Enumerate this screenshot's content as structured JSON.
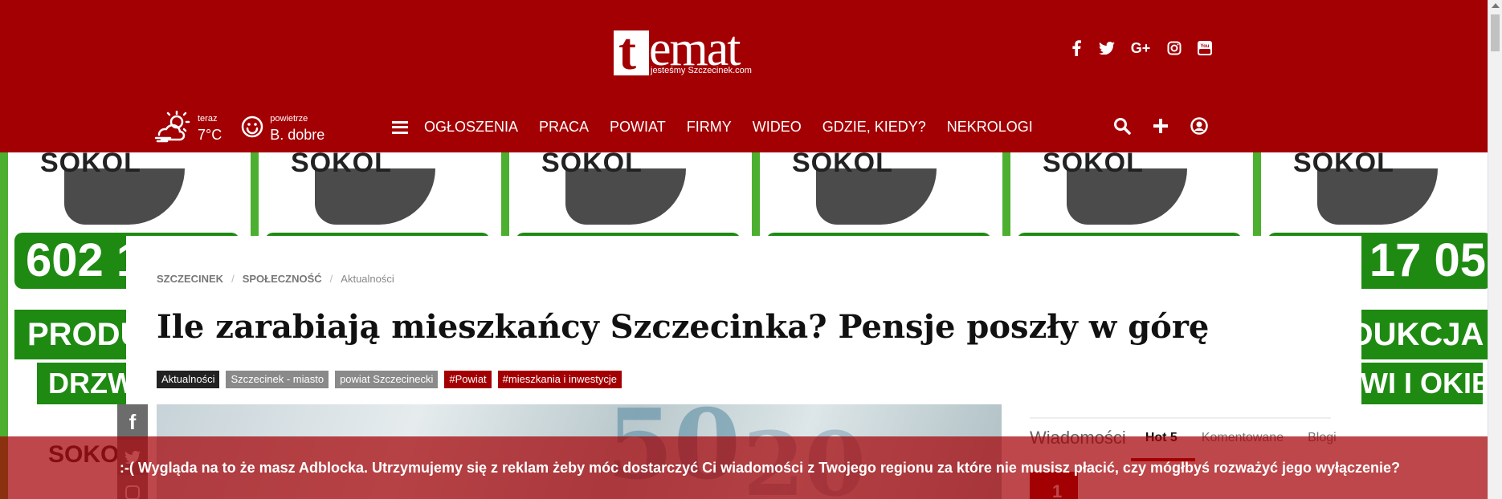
{
  "brand": {
    "logo_word": "emat",
    "logo_initial": "t",
    "tagline": "jesteśmy Szczecinek.com",
    "accent_color": "#a30004"
  },
  "social_icons": [
    "facebook-icon",
    "twitter-icon",
    "google-plus-icon",
    "instagram-icon",
    "youtube-icon"
  ],
  "weather": {
    "now_label": "teraz",
    "temperature": "7°C",
    "air_label": "powietrze",
    "air_quality": "B. dobre"
  },
  "nav": {
    "items": [
      "OGŁOSZENIA",
      "PRACA",
      "POWIAT",
      "FIRMY",
      "WIDEO",
      "GDZIE, KIEDY?",
      "NEKROLOGI"
    ]
  },
  "tools": [
    "search-icon",
    "plus-icon",
    "user-icon"
  ],
  "background_ad": {
    "top_text": "SOKOL",
    "phone": "602 17 05 17",
    "line1": "PRODUKCJA",
    "line2": "DRZWI I OKIEN"
  },
  "article": {
    "breadcrumbs": [
      "SZCZECINEK",
      "SPOŁECZNOŚĆ",
      "Aktualności"
    ],
    "title": "Ile zarabiają mieszkańcy Szczecinka? Pensje poszły w górę",
    "tags": [
      {
        "label": "Aktualności",
        "style": "dark"
      },
      {
        "label": "Szczecinek - miasto",
        "style": "gray"
      },
      {
        "label": "powiat Szczecinecki",
        "style": "gray"
      },
      {
        "label": "#Powiat",
        "style": "red"
      },
      {
        "label": "#mieszkania i inwestycje",
        "style": "red"
      }
    ]
  },
  "sidebar": {
    "tabs": [
      "Wiadomości",
      "Hot 5",
      "Komentowane",
      "Blogi"
    ],
    "active_tab": "Hot 5",
    "first_rank": "1"
  },
  "adblock_notice": ":-( Wygląda na to że masz Adblocka. Utrzymujemy się z reklam żeby móc dostarczyć Ci wiadomości z Twojego regionu za które nie musisz płacić, czy mógłbyś rozważyć jego wyłączenie?"
}
